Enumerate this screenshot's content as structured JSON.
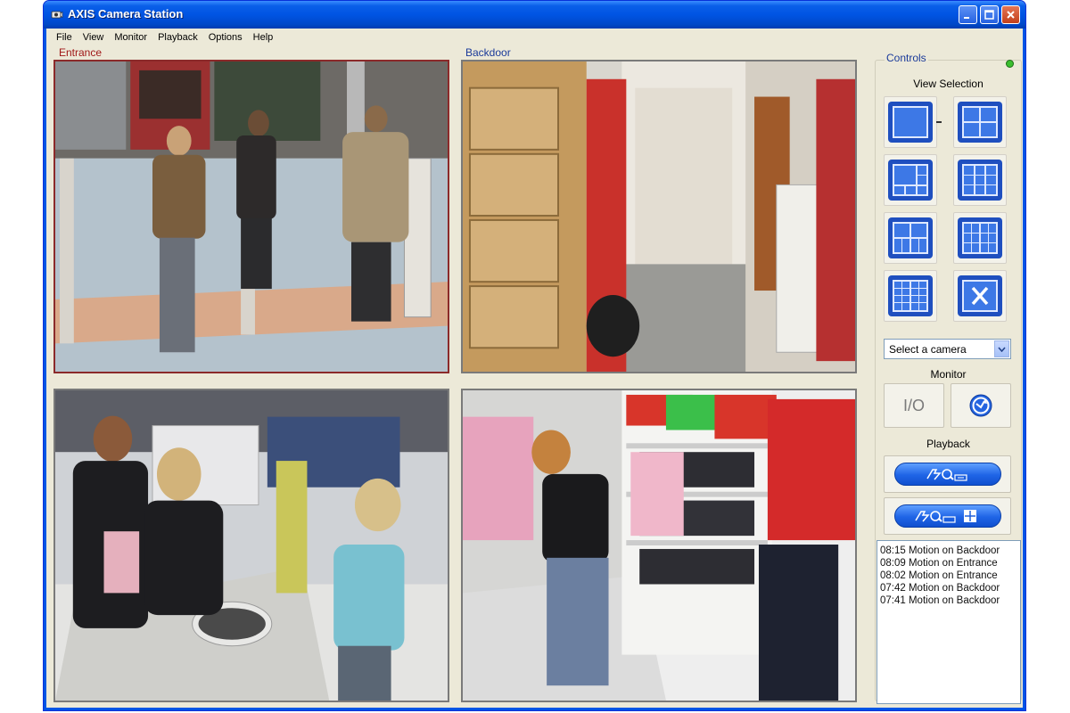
{
  "window": {
    "title": "AXIS Camera Station",
    "buttons": {
      "minimize": "minimize-icon",
      "maximize": "maximize-icon",
      "close": "close-icon"
    }
  },
  "menu": {
    "items": [
      {
        "label": "File"
      },
      {
        "label": "View"
      },
      {
        "label": "Monitor"
      },
      {
        "label": "Playback"
      },
      {
        "label": "Options"
      },
      {
        "label": "Help"
      }
    ]
  },
  "cameras": [
    {
      "label": "Entrance",
      "active": true,
      "label_color": "#a01818"
    },
    {
      "label": "Backdoor",
      "active": false,
      "label_color": "#1a3a9a"
    },
    {
      "label": "",
      "active": false
    },
    {
      "label": "",
      "active": false
    }
  ],
  "controls": {
    "title": "Controls",
    "status_color": "#3bbf2f",
    "view_selection": {
      "label": "View Selection",
      "buttons": [
        {
          "name": "view-1x1-icon"
        },
        {
          "name": "view-2x2-icon"
        },
        {
          "name": "view-1plus5-icon"
        },
        {
          "name": "view-3x3-icon"
        },
        {
          "name": "view-1plus7-icon"
        },
        {
          "name": "view-3x4-icon"
        },
        {
          "name": "view-4x4-icon"
        },
        {
          "name": "view-close-icon"
        }
      ]
    },
    "camera_select": {
      "value": "Select a camera"
    },
    "monitor": {
      "label": "Monitor",
      "io_label": "I/O"
    },
    "playback": {
      "label": "Playback"
    },
    "accent_color": "#1f64e6"
  },
  "event_log": {
    "items": [
      "08:15 Motion on Backdoor",
      "08:09 Motion on Entrance",
      "08:02 Motion on Entrance",
      "07:42 Motion on Backdoor",
      "07:41 Motion on Backdoor"
    ]
  }
}
